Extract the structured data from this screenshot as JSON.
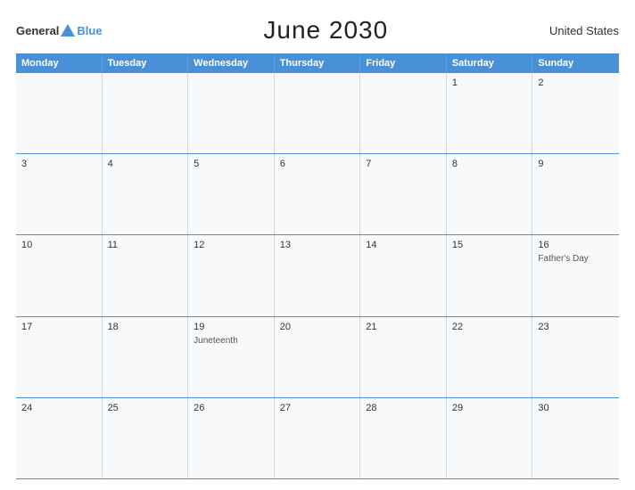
{
  "header": {
    "logo_general": "General",
    "logo_blue": "Blue",
    "title": "June 2030",
    "country": "United States"
  },
  "calendar": {
    "days_of_week": [
      "Monday",
      "Tuesday",
      "Wednesday",
      "Thursday",
      "Friday",
      "Saturday",
      "Sunday"
    ],
    "weeks": [
      [
        {
          "day": "",
          "event": ""
        },
        {
          "day": "",
          "event": ""
        },
        {
          "day": "",
          "event": ""
        },
        {
          "day": "",
          "event": ""
        },
        {
          "day": "",
          "event": ""
        },
        {
          "day": "1",
          "event": ""
        },
        {
          "day": "2",
          "event": ""
        }
      ],
      [
        {
          "day": "3",
          "event": ""
        },
        {
          "day": "4",
          "event": ""
        },
        {
          "day": "5",
          "event": ""
        },
        {
          "day": "6",
          "event": ""
        },
        {
          "day": "7",
          "event": ""
        },
        {
          "day": "8",
          "event": ""
        },
        {
          "day": "9",
          "event": ""
        }
      ],
      [
        {
          "day": "10",
          "event": ""
        },
        {
          "day": "11",
          "event": ""
        },
        {
          "day": "12",
          "event": ""
        },
        {
          "day": "13",
          "event": ""
        },
        {
          "day": "14",
          "event": ""
        },
        {
          "day": "15",
          "event": ""
        },
        {
          "day": "16",
          "event": "Father's Day"
        }
      ],
      [
        {
          "day": "17",
          "event": ""
        },
        {
          "day": "18",
          "event": ""
        },
        {
          "day": "19",
          "event": "Juneteenth"
        },
        {
          "day": "20",
          "event": ""
        },
        {
          "day": "21",
          "event": ""
        },
        {
          "day": "22",
          "event": ""
        },
        {
          "day": "23",
          "event": ""
        }
      ],
      [
        {
          "day": "24",
          "event": ""
        },
        {
          "day": "25",
          "event": ""
        },
        {
          "day": "26",
          "event": ""
        },
        {
          "day": "27",
          "event": ""
        },
        {
          "day": "28",
          "event": ""
        },
        {
          "day": "29",
          "event": ""
        },
        {
          "day": "30",
          "event": ""
        }
      ]
    ]
  }
}
